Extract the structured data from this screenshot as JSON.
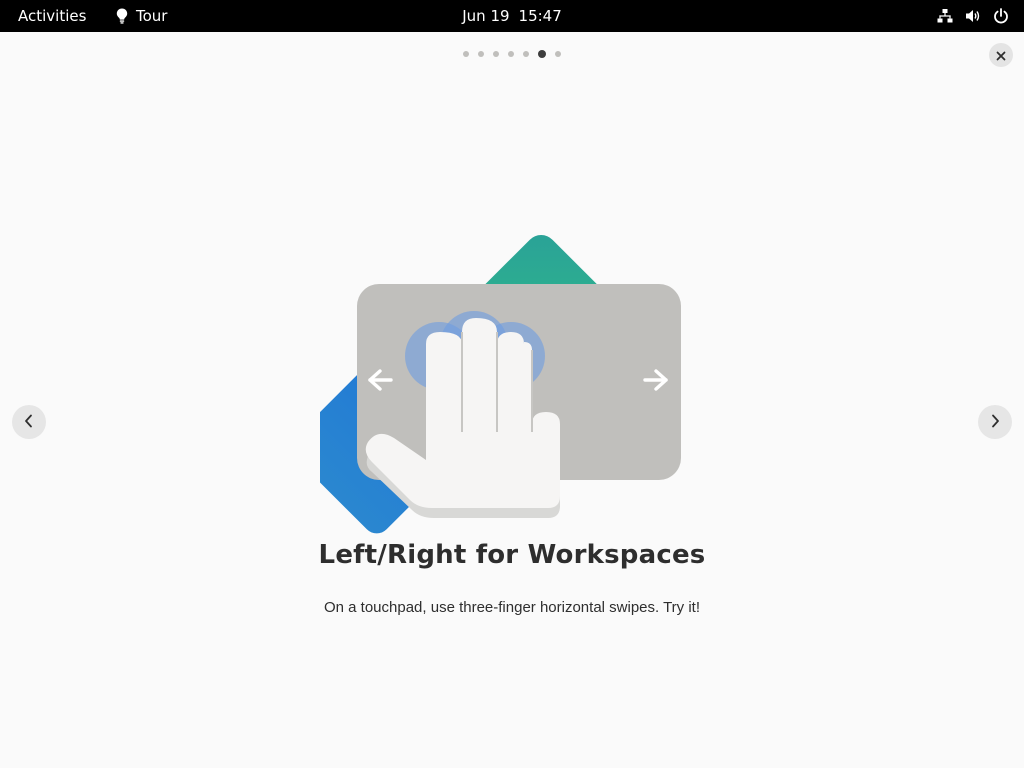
{
  "topbar": {
    "activities_label": "Activities",
    "app_name": "Tour",
    "app_icon": "lightbulb-icon",
    "date": "Jun 19",
    "time": "15:47",
    "tray_icons": [
      "network-icon",
      "volume-icon",
      "power-icon"
    ]
  },
  "tour": {
    "total_pages": 7,
    "current_page": 6,
    "close_icon": "close-icon",
    "prev_icon": "chevron-left-icon",
    "next_icon": "chevron-right-icon",
    "title": "Left/Right for Workspaces",
    "description": "On a touchpad, use three-finger horizontal swipes. Try it!"
  },
  "colors": {
    "topbar_bg": "#000000",
    "window_bg": "#fafafa",
    "text": "#2e2e2e",
    "dot_inactive": "#c0bfbc",
    "dot_active": "#3d3d3d",
    "workspace_blue": "#1c71d8",
    "workspace_teal": "#26a269",
    "touchpad_gray": "#c0bfbc"
  }
}
